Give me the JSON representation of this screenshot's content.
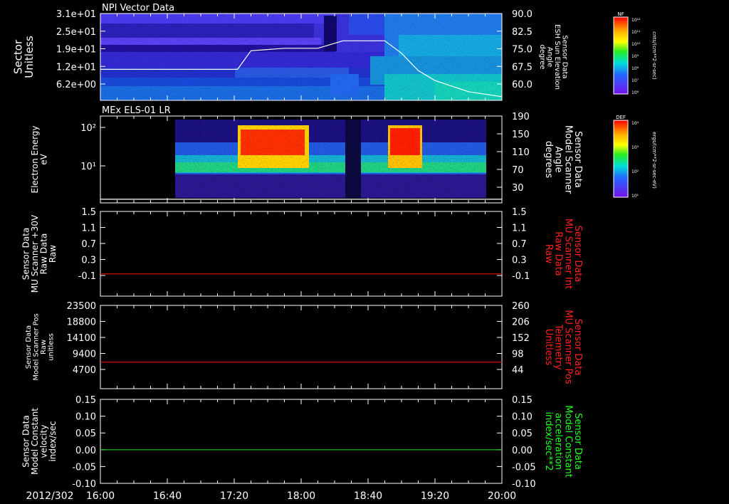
{
  "time_axis": {
    "date": "2012/302",
    "ticks": [
      "16:00",
      "16:40",
      "17:20",
      "18:00",
      "18:40",
      "19:20",
      "20:00"
    ]
  },
  "colors": {
    "axis": "#ffffff",
    "red_trace": "#e01010",
    "green_trace": "#10d010",
    "label_red": "#ff2020",
    "label_green": "#20ff20"
  },
  "chart_data": [
    {
      "type": "heatmap",
      "title": "NPI Vector Data",
      "ylabel": "Sector\nUnitless",
      "y_ticks": [
        "3.1e+01",
        "2.5e+01",
        "1.9e+01",
        "1.2e+01",
        "6.2e+00"
      ],
      "y2label": "Sensor Data\nESH Sun Elevation\nAngle\ndegree",
      "y2_ticks": [
        "90.0",
        "82.5",
        "75.0",
        "67.5",
        "60.0"
      ],
      "y2lim": [
        55,
        90
      ],
      "colorbar": {
        "label": "NF",
        "units": "cnts/(cm**2-sr-sec)",
        "ticks": [
          "10¹²",
          "10¹¹",
          "10¹⁰",
          "10⁹",
          "10⁸",
          "10⁷",
          "10⁶"
        ]
      },
      "overlay_line": {
        "x": [
          "16:00",
          "17:10",
          "17:22",
          "17:30",
          "17:50",
          "18:10",
          "18:25",
          "18:40",
          "18:50",
          "19:00",
          "19:10",
          "19:20",
          "19:40",
          "20:00"
        ],
        "y": [
          67.5,
          67.5,
          67.5,
          75.0,
          76.0,
          76.0,
          79.0,
          79.0,
          79.0,
          74.0,
          67.0,
          63.0,
          58.5,
          56.5
        ]
      }
    },
    {
      "type": "heatmap",
      "title": "MEx ELS-01 LR",
      "ylabel": "Electron Energy\neV",
      "y_ticks": [
        "10²",
        "10¹"
      ],
      "y2label": "Sensor Data\nModel Scanner\nAngle\ndegrees",
      "y2_ticks": [
        "190",
        "150",
        "110",
        "70",
        "30"
      ],
      "y2lim": [
        0,
        190
      ],
      "colorbar": {
        "label": "DEF",
        "units": "ergs/(cm**2-sr-sec-eV)",
        "ticks": [
          "10⁴",
          "10³",
          "10²",
          "10¹"
        ]
      },
      "overlay_line": {
        "x": [
          "16:00",
          "20:00"
        ],
        "y": [
          8,
          8
        ]
      }
    },
    {
      "type": "line",
      "ylabel": "Sensor Data\nMU Scanner +30V\nRaw Data\nRaw",
      "y_ticks": [
        "1.5",
        "1.1",
        "0.7",
        "0.3",
        "-0.1"
      ],
      "ylim": [
        -0.4,
        1.5
      ],
      "y2label": "Sensor Data\nMU Scanner Int\nRaw Data\nRaw",
      "y2_ticks": [
        "1.5",
        "1.1",
        "0.7",
        "0.3",
        "-0.1"
      ],
      "series": [
        {
          "x": [
            "16:00",
            "20:00"
          ],
          "values": [
            0.1,
            0.1
          ]
        }
      ]
    },
    {
      "type": "line",
      "ylabel": "Sensor Data\nModel Scanner Pos\nRaw\nunitless",
      "y_ticks": [
        "23500",
        "18800",
        "14100",
        "9400",
        "4700"
      ],
      "ylim": [
        0,
        23500
      ],
      "y2label": "Sensor Data\nMU Scanner Pos\nTelemetry\nUnitless",
      "y2_ticks": [
        "260",
        "206",
        "152",
        "98",
        "44"
      ],
      "series": [
        {
          "x": [
            "16:00",
            "20:00"
          ],
          "values": [
            7500,
            7500
          ]
        }
      ]
    },
    {
      "type": "line",
      "ylabel": "Sensor Data\nModel Constant\nvelocity\nindex/sec",
      "y_ticks": [
        "0.15",
        "0.10",
        "0.05",
        "0.00",
        "-0.05",
        "-0.10"
      ],
      "ylim": [
        -0.1,
        0.15
      ],
      "y2label": "Sensor Data\nModel Constant\nacceleration\nindex/sec**2",
      "y2_ticks": [
        "0.15",
        "0.10",
        "0.05",
        "0.00",
        "-0.05",
        "-0.10"
      ],
      "series": [
        {
          "x": [
            "16:00",
            "20:00"
          ],
          "values": [
            0.0,
            0.0
          ]
        }
      ]
    }
  ]
}
